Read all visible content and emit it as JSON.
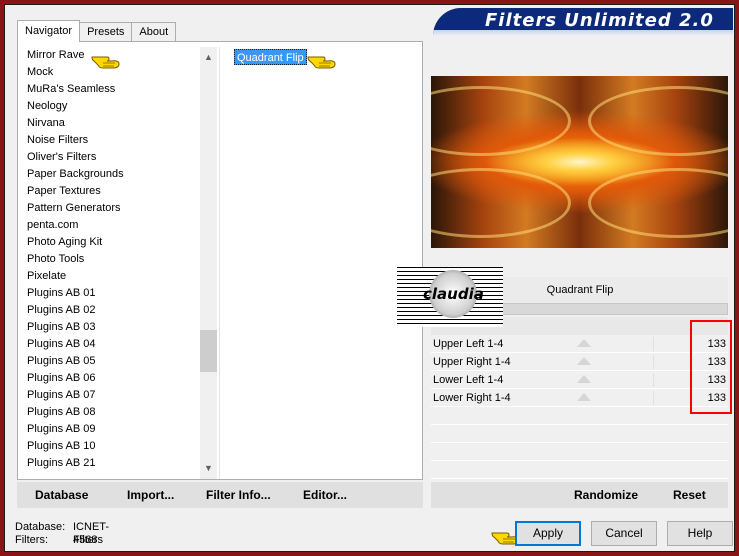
{
  "window": {
    "title": "Filters Unlimited 2.0"
  },
  "tabs": [
    {
      "label": "Navigator",
      "active": true
    },
    {
      "label": "Presets",
      "active": false
    },
    {
      "label": "About",
      "active": false
    }
  ],
  "categories": [
    "Mirror Rave",
    "Mock",
    "MuRa's Seamless",
    "Neology",
    "Nirvana",
    "Noise Filters",
    "Oliver's Filters",
    "Paper Backgrounds",
    "Paper Textures",
    "Pattern Generators",
    "penta.com",
    "Photo Aging Kit",
    "Photo Tools",
    "Pixelate",
    "Plugins AB 01",
    "Plugins AB 02",
    "Plugins AB 03",
    "Plugins AB 04",
    "Plugins AB 05",
    "Plugins AB 06",
    "Plugins AB 07",
    "Plugins AB 08",
    "Plugins AB 09",
    "Plugins AB 10",
    "Plugins AB 21"
  ],
  "selected_filter": "Quadrant Flip",
  "filter_name": "Quadrant Flip",
  "params": [
    {
      "label": "Upper Left 1-4",
      "value": "133"
    },
    {
      "label": "Upper Right 1-4",
      "value": "133"
    },
    {
      "label": "Lower Left 1-4",
      "value": "133"
    },
    {
      "label": "Lower Right 1-4",
      "value": "133"
    }
  ],
  "toolbar": {
    "database": "Database",
    "import": "Import...",
    "filter_info": "Filter Info...",
    "editor": "Editor...",
    "randomize": "Randomize",
    "reset": "Reset"
  },
  "status": {
    "database_label": "Database:",
    "database_value": "ICNET-Filters",
    "filters_label": "Filters:",
    "filters_value": "4568"
  },
  "buttons": {
    "apply": "Apply",
    "cancel": "Cancel",
    "help": "Help"
  },
  "logo": {
    "text": "claudia"
  },
  "colors": {
    "frame": "#8a1516",
    "banner": "#0d2a7a",
    "selection": "#3399ff",
    "highlight_box": "#ff0000"
  },
  "icons": {
    "pointer": "hand-pointer-icon"
  }
}
